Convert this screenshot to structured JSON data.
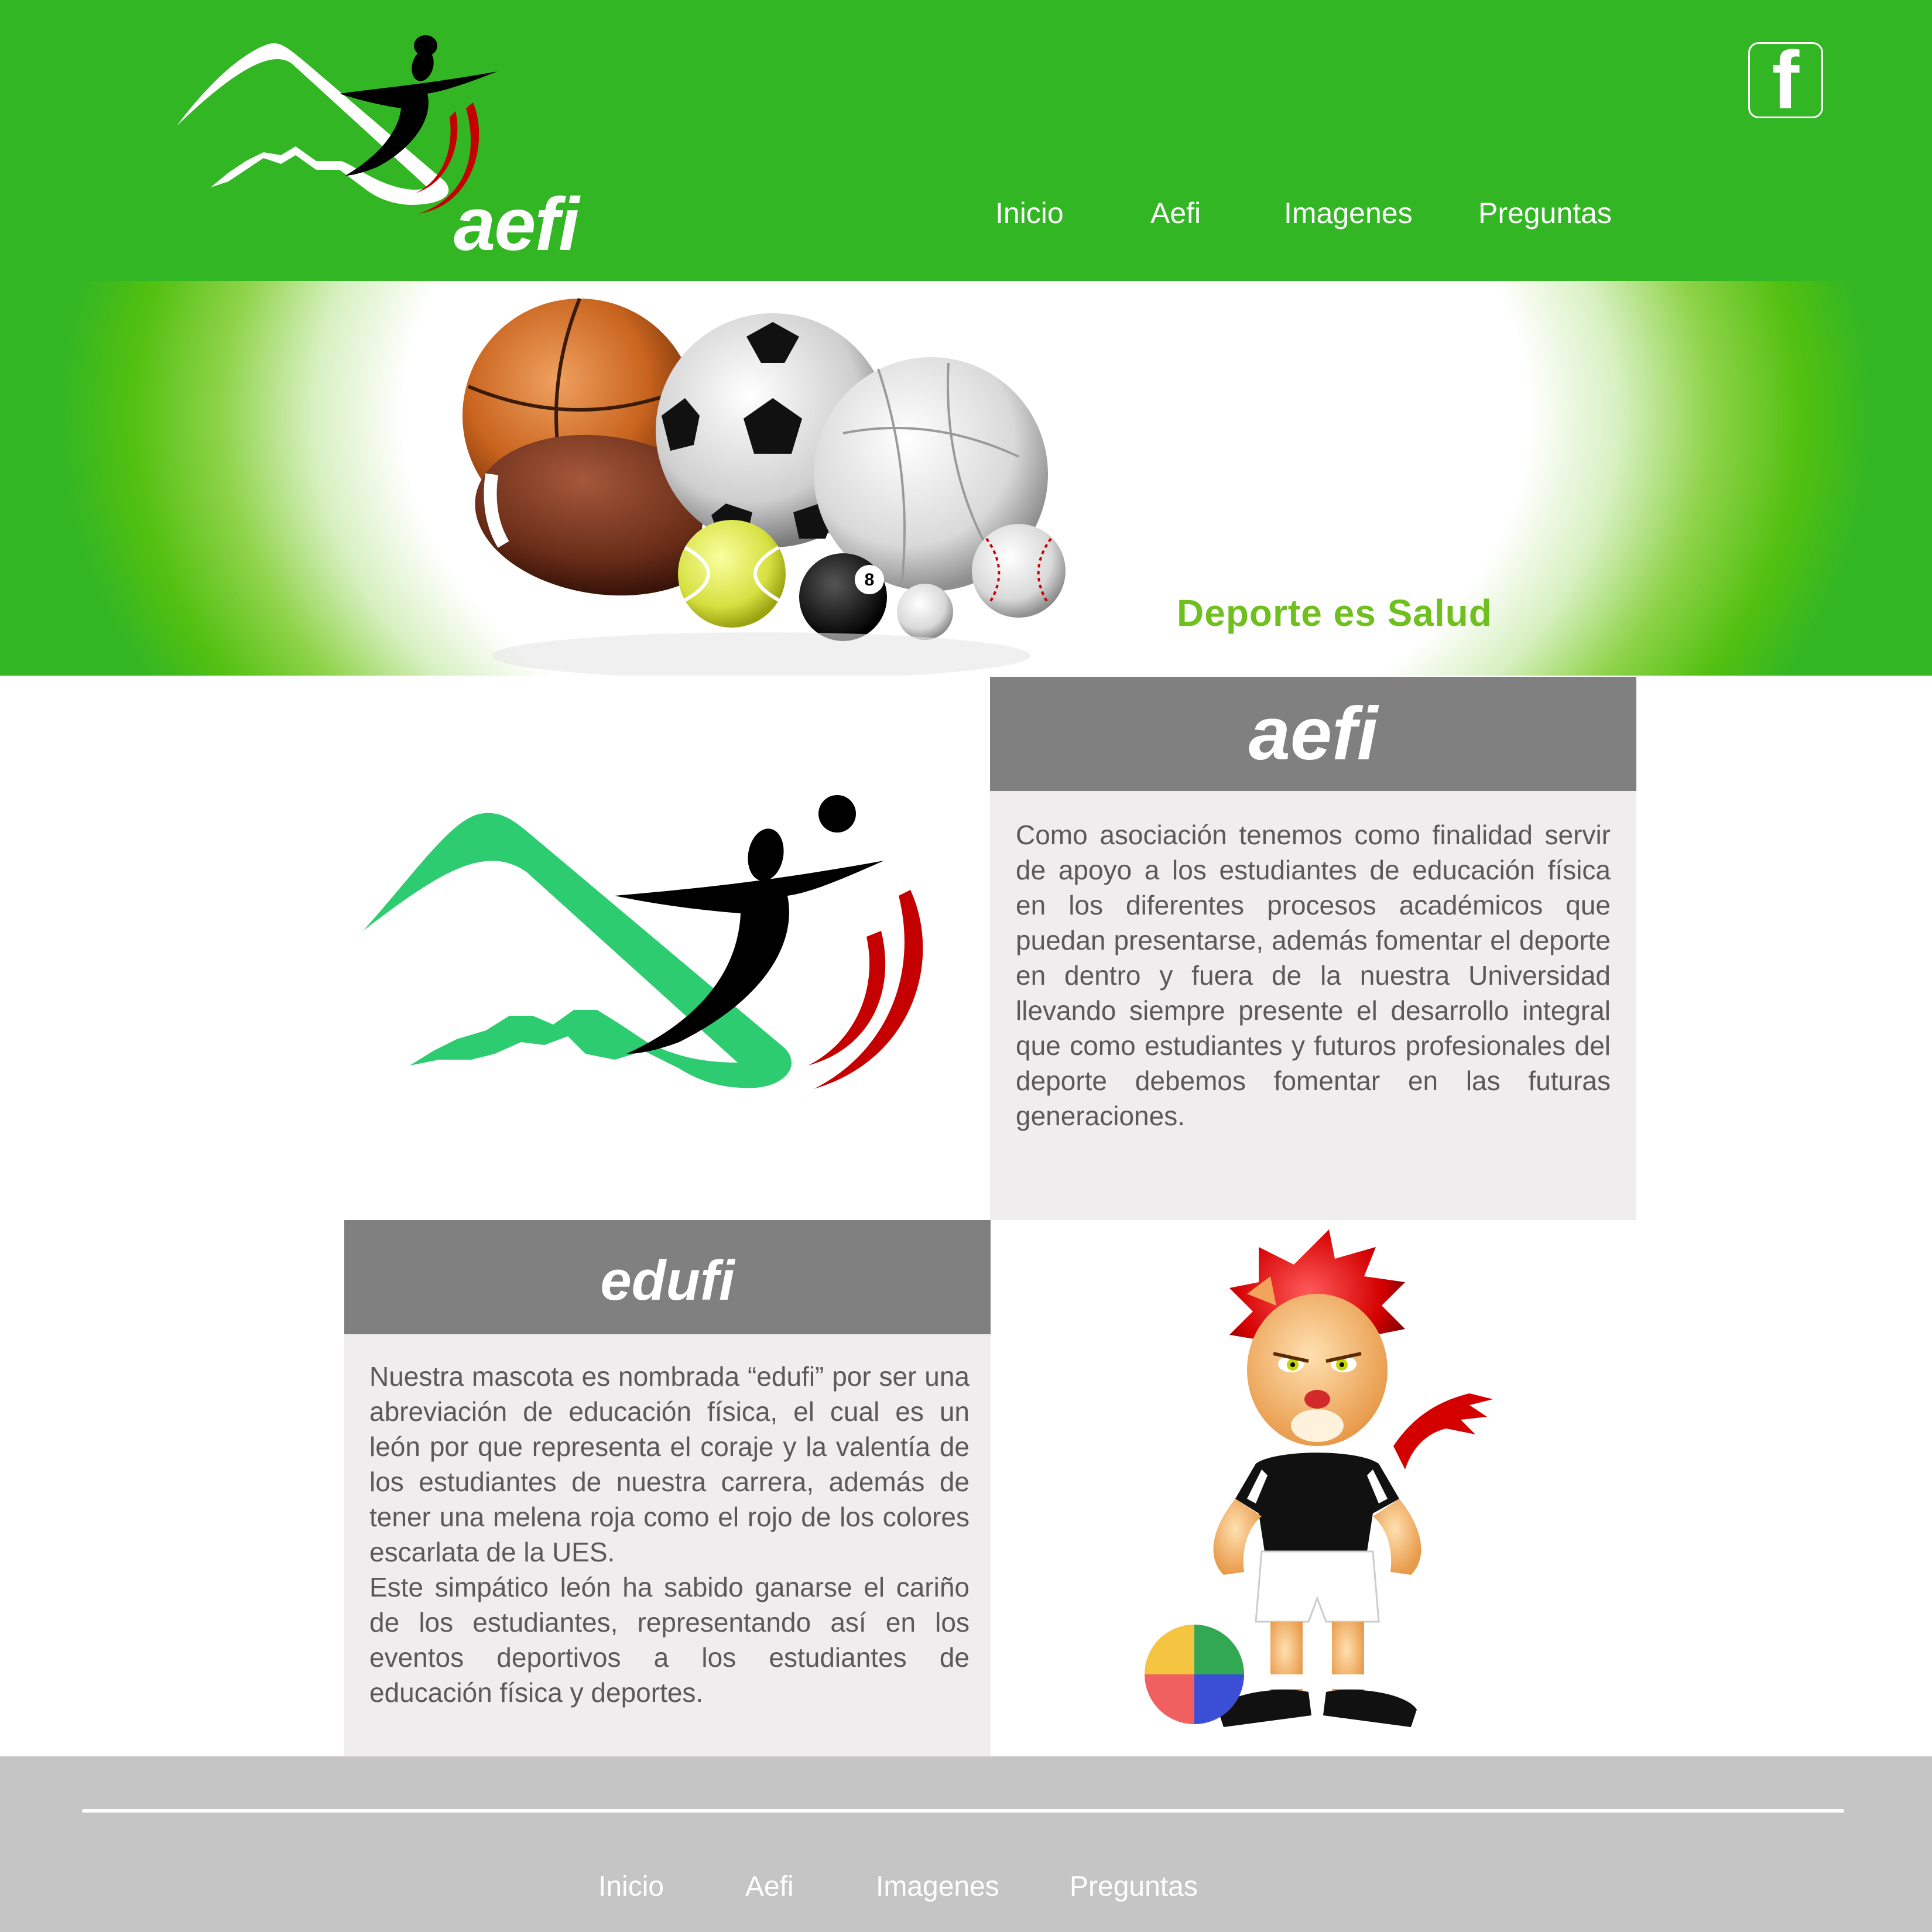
{
  "header": {
    "brand": "aefi",
    "nav": [
      "Inicio",
      "Aefi",
      "Imagenes",
      "Preguntas"
    ],
    "social_icon": "facebook-icon",
    "social_glyph": "f"
  },
  "banner": {
    "slogan": "Deporte es Salud",
    "eight_ball_number": "8"
  },
  "aefi_section": {
    "title": "aefi",
    "text": "Como asociación tenemos como finalidad servir de apoyo a los estudiantes de educación física en los diferentes procesos académicos que puedan presentarse, además fomentar el deporte en dentro y fuera de la nuestra Universidad llevando siempre presente el desarrollo integral que como estudiantes y futuros profesionales del deporte debemos fomentar en las futuras generaciones."
  },
  "edufi_section": {
    "title": "edufi",
    "paragraphs": [
      "Nuestra mascota es nombrada “edufi” por ser una abreviación de educación física, el cual es un león por que representa el coraje y la valentía de los estudiantes de nuestra carrera, además de tener una melena roja como el rojo de los colores escarlata de la UES.",
      "Este simpático león ha sabido ganarse el cariño de los estudiantes, representando así en los eventos deportivos a los estudiantes de educación física y deportes."
    ]
  },
  "footer": {
    "nav": [
      "Inicio",
      "Aefi",
      "Imagenes",
      "Preguntas"
    ]
  },
  "colors": {
    "header_green": "#33b624",
    "slogan_green": "#6fbf1e",
    "card_header_gray": "#808080",
    "card_body_gray": "#efeded",
    "footer_gray": "#c6c5c6",
    "logo_green": "#2ecc71",
    "accent_red": "#c40000"
  }
}
